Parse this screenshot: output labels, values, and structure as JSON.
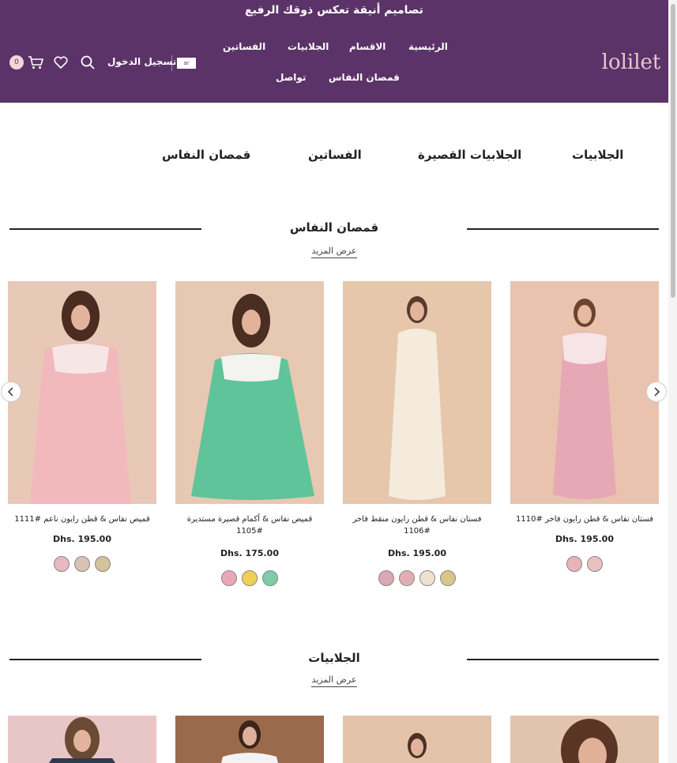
{
  "header": {
    "announcement": "تصاميم أنيقة تعكس ذوقك الرفيع",
    "logo_text": "lolilet",
    "nav": [
      "الرئيسية",
      "الاقسام",
      "الجلابيات",
      "الفساتين",
      "قمصان النفاس",
      "تواصل"
    ],
    "lang": "ar",
    "login": "تسجيل الدخول",
    "cart_count": "0",
    "colors": {
      "bar": "#5c3368",
      "logo": "#e9c7cf"
    }
  },
  "categories": [
    "الجلابيات",
    "الجلابيات القصيرة",
    "الفساتين",
    "قمصان النفاس"
  ],
  "section1": {
    "title": "قمصان النفاس",
    "view_more": "عرض المزيد",
    "products": [
      {
        "name": "فستان نفاس & قطن رايون فاخر #1110",
        "price": "Dhs. 195.00",
        "swatches": [
          "#e8b4b8",
          "#e9c2c0"
        ]
      },
      {
        "name": "فستان نفاس & قطن رايون منقط فاخر #1106",
        "price": "Dhs. 195.00",
        "swatches": [
          "#d9a8b2",
          "#e2aeb4",
          "#efe1d0",
          "#d8c58b"
        ]
      },
      {
        "name": "قميص نفاس & أكمام قصيرة مستديرة 1105#",
        "price": "Dhs. 175.00",
        "swatches": [
          "#e9a8b8",
          "#f0cf58",
          "#7fcca8"
        ]
      },
      {
        "name": "قميص نفاس & قطن رايون ناعم #1111",
        "price": "Dhs. 195.00",
        "swatches": [
          "#e9b8c0",
          "#d9c1b3",
          "#d3c29a"
        ]
      }
    ]
  },
  "section2": {
    "title": "الجلابيات",
    "view_more": "عرض المزيد"
  }
}
